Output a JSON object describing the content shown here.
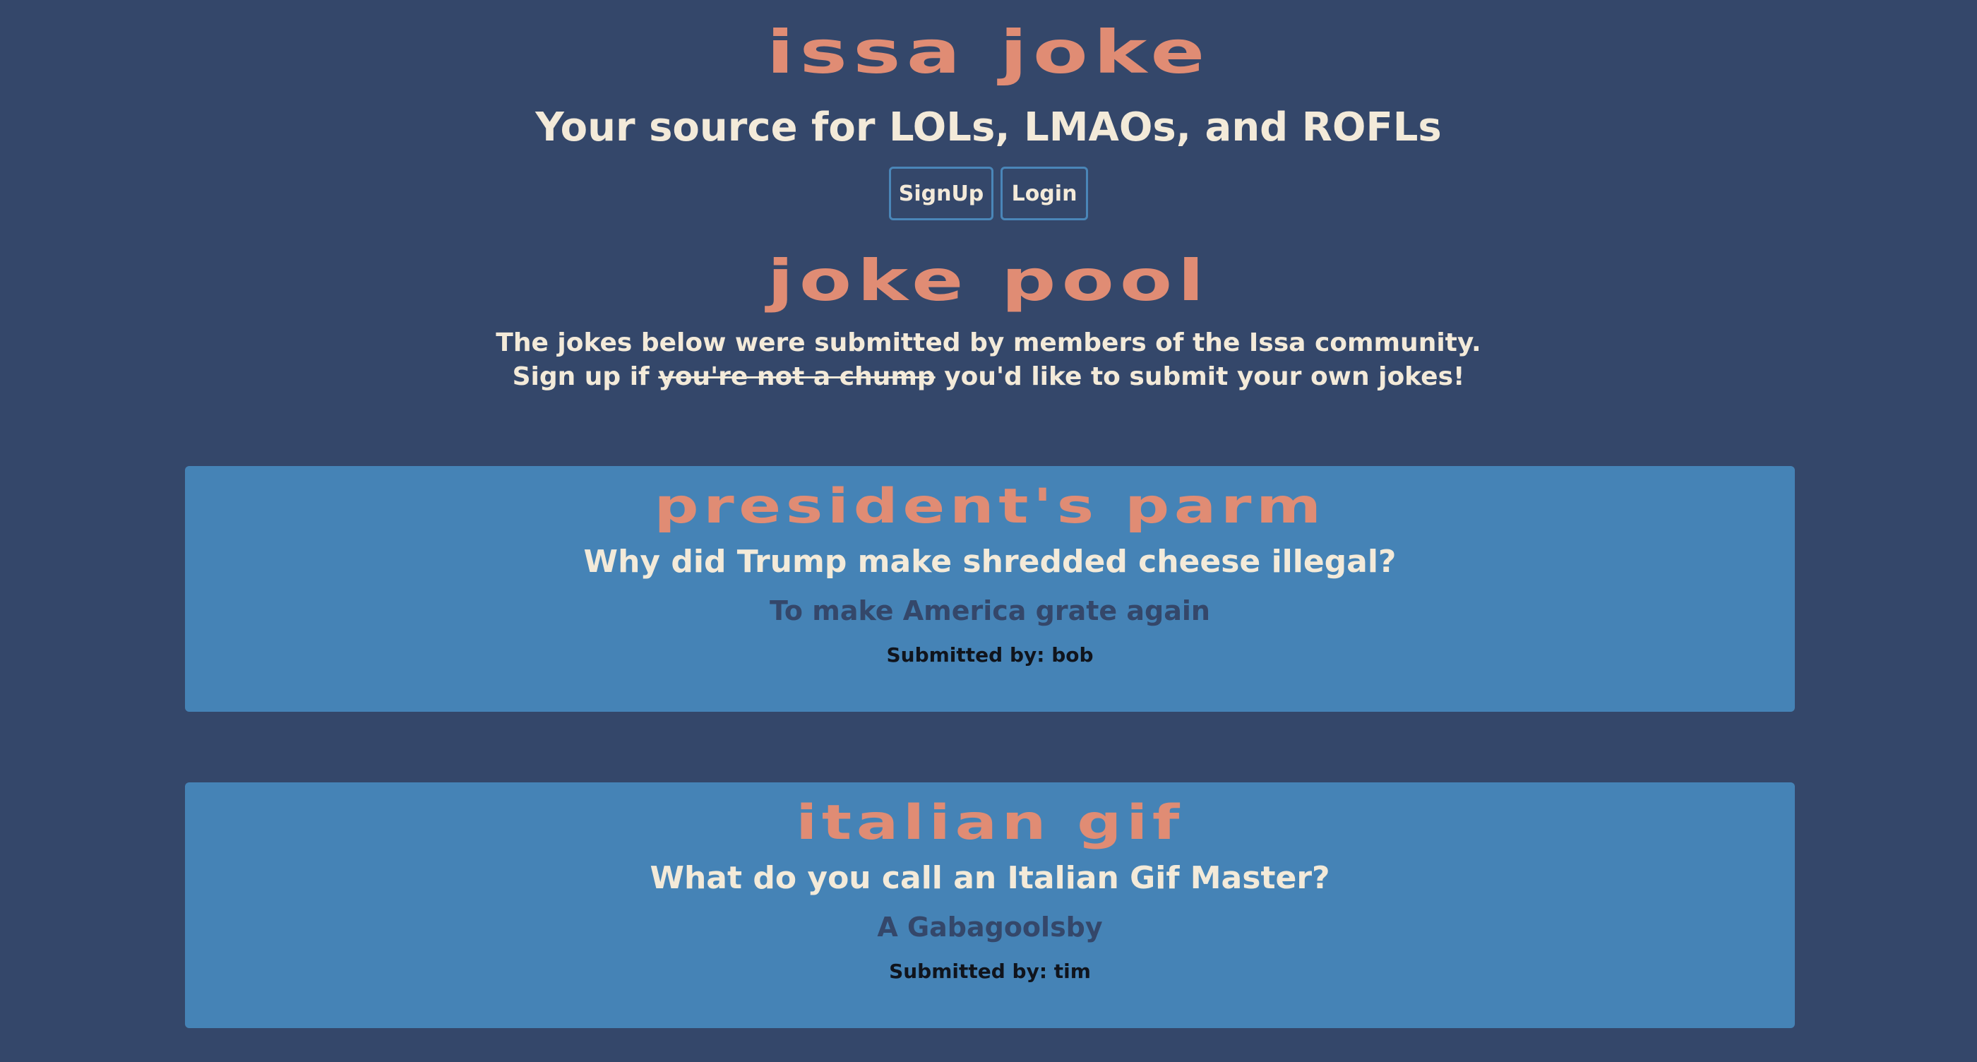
{
  "header": {
    "title": "Issa Joke",
    "tagline": "Your source for LOLs, LMAOs, and ROFLs"
  },
  "auth": {
    "signup_label": "SignUp",
    "login_label": "Login"
  },
  "pool": {
    "title": "Joke Pool",
    "intro_line1": "The jokes below were submitted by members of the Issa community.",
    "intro_line2_prefix": "Sign up if",
    "intro_line2_struck": "you're not a chump",
    "intro_line2_suffix": "you'd like to submit your own jokes!"
  },
  "jokes": [
    {
      "title": "President's Parm",
      "setup": "Why did Trump make shredded cheese illegal?",
      "punchline": "To make America grate again",
      "submitted_by": "Submitted by: bob"
    },
    {
      "title": "Italian Gif",
      "setup": "What do you call an Italian Gif Master?",
      "punchline": "A Gabagoolsby",
      "submitted_by": "Submitted by: tim"
    }
  ],
  "colors": {
    "background": "#34476a",
    "accent": "#e08c74",
    "card": "#4583b6",
    "text": "#f3ead9"
  }
}
